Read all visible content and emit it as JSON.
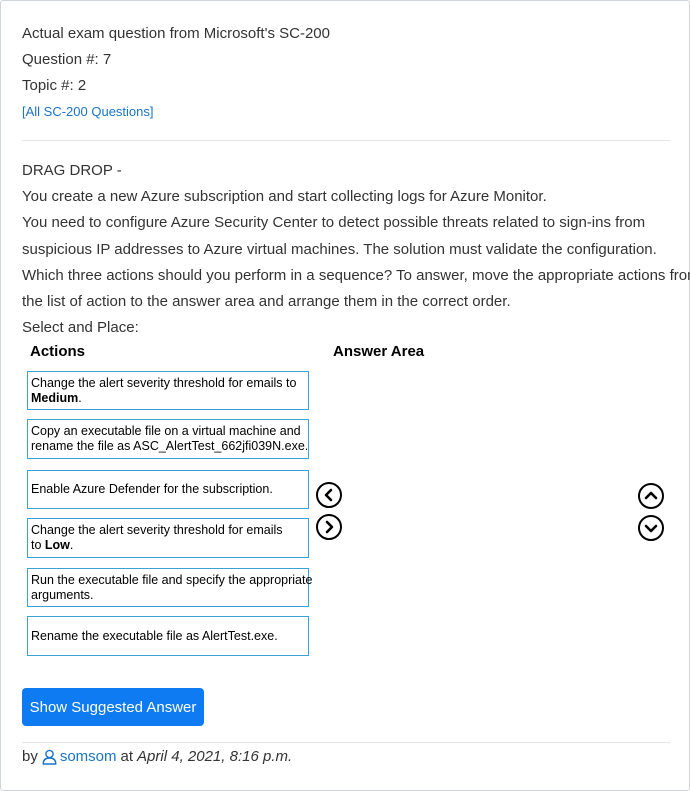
{
  "header": {
    "title": "Actual exam question from Microsoft's SC-200",
    "question_number": "Question #: 7",
    "topic": "Topic #: 2",
    "all_questions_link": "[All SC-200 Questions]"
  },
  "question": {
    "type_label": "DRAG DROP -",
    "lines": [
      "You create a new Azure subscription and start collecting logs for Azure Monitor.",
      "You need to configure Azure Security Center to detect possible threats related to sign-ins from",
      "suspicious IP addresses to Azure virtual machines. The solution must validate the configuration.",
      "Which three actions should you perform in a sequence? To answer, move the appropriate actions from",
      "the list of action to the answer area and arrange them in the correct order.",
      "Select and Place:"
    ]
  },
  "drag_drop": {
    "actions_title": "Actions",
    "answer_area_title": "Answer Area",
    "actions": [
      {
        "line1": "Change the alert severity threshold for emails to",
        "line2_bold": "Medium",
        "line2_suffix": "."
      },
      {
        "line1": "Copy an executable file on a virtual machine and",
        "line2": "rename the file as ASC_AlertTest_662jfi039N.exe."
      },
      {
        "line1": "Enable Azure Defender for the subscription."
      },
      {
        "line1": "Change the alert severity threshold for emails",
        "line2_prefix": "to ",
        "line2_bold": "Low",
        "line2_suffix": "."
      },
      {
        "line1": "Run the executable file and specify the appropriate",
        "line2": "arguments."
      },
      {
        "line1": "Rename the executable file as AlertTest.exe."
      }
    ],
    "icons": {
      "move_left": "chevron-left-circle-icon",
      "move_right": "chevron-right-circle-icon",
      "move_up": "chevron-up-circle-icon",
      "move_down": "chevron-down-circle-icon"
    }
  },
  "show_answer_button": "Show Suggested Answer",
  "footer": {
    "by": "by",
    "username": "somsom",
    "at": "at",
    "date": "April 4, 2021, 8:16 p.m."
  },
  "colors": {
    "link": "#1a73c8",
    "primary_button": "#0f7bf3",
    "action_border": "#3aa3d3"
  }
}
